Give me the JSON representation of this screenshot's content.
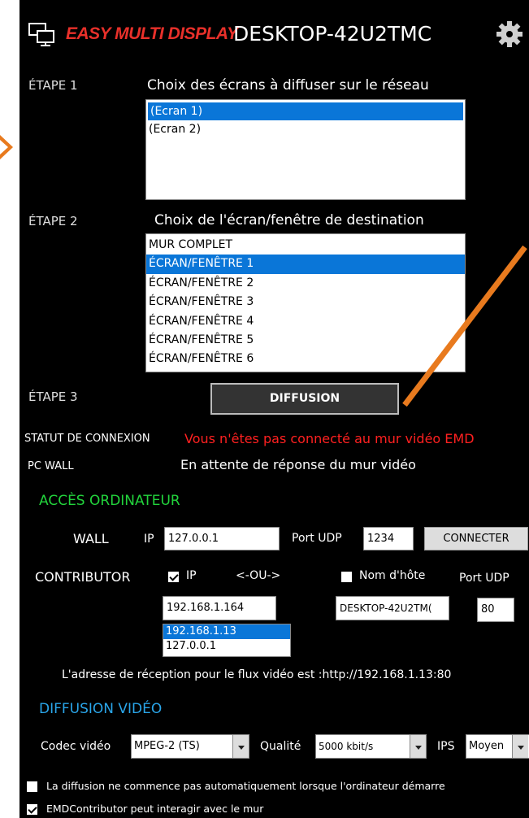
{
  "header": {
    "brand": "EASY MULTI DISPLAY",
    "title": "DESKTOP-42U2TMC",
    "icons": [
      "monitor-network-icon",
      "gear-icon"
    ]
  },
  "step1": {
    "label": "ÉTAPE 1",
    "title": "Choix des écrans à diffuser sur le réseau",
    "items": [
      "(Ecran 1)",
      "(Ecran 2)"
    ],
    "selected": 0
  },
  "step2": {
    "label": "ÉTAPE 2",
    "title": "Choix de l'écran/fenêtre de destination",
    "items": [
      "MUR COMPLET",
      "ÉCRAN/FENÊTRE 1",
      "ÉCRAN/FENÊTRE 2",
      "ÉCRAN/FENÊTRE 3",
      "ÉCRAN/FENÊTRE 4",
      "ÉCRAN/FENÊTRE 5",
      "ÉCRAN/FENÊTRE 6"
    ],
    "selected": 1
  },
  "step3": {
    "label": "ÉTAPE 3",
    "button": "DIFFUSION"
  },
  "status": {
    "connection_label": "STATUT DE CONNEXION",
    "connection_value": "Vous n'êtes pas connecté au mur vidéo EMD",
    "pcwall_label": "PC WALL",
    "pcwall_value": "En attente de réponse du mur vidéo"
  },
  "access": {
    "title": "ACCÈS ORDINATEUR",
    "wall_label": "WALL",
    "ip_label": "IP",
    "wall_ip": "127.0.0.1",
    "port_label": "Port UDP",
    "wall_port": "1234",
    "connect_button": "CONNECTER",
    "contributor_label": "CONTRIBUTOR",
    "contrib_ip_label": "IP",
    "or_label": "<-OU->",
    "hostname_label": "Nom d'hôte",
    "port_label2": "Port UDP",
    "contrib_ip": "192.168.1.164",
    "contrib_host": "DESKTOP-42U2TM(",
    "contrib_port": "80",
    "ip_list": [
      "192.168.1.13",
      "127.0.0.1"
    ],
    "ip_list_selected": 0,
    "reception_text": "L'adresse de réception pour le flux vidéo est :http://192.168.1.13:80",
    "ip_checked": true,
    "hostname_checked": false
  },
  "video": {
    "title": "DIFFUSION VIDÉO",
    "codec_label": "Codec vidéo",
    "codec_value": "MPEG-2  (TS)",
    "quality_label": "Qualité",
    "quality_value": "5000 kbit/s",
    "ips_label": "IPS",
    "ips_value": "Moyen"
  },
  "options": {
    "autostart_label": "La diffusion ne commence pas automatiquement lorsque l'ordinateur démarre",
    "autostart_checked": false,
    "interact_label": "EMDContributor peut interagir avec le mur",
    "interact_checked": true
  },
  "colors": {
    "accent_green": "#22d43c",
    "accent_blue": "#2aa6ea",
    "error_red": "#ff2020",
    "selection": "#0a76d8",
    "brand_red": "#e8302a",
    "annotation_orange": "#e87a1e"
  }
}
